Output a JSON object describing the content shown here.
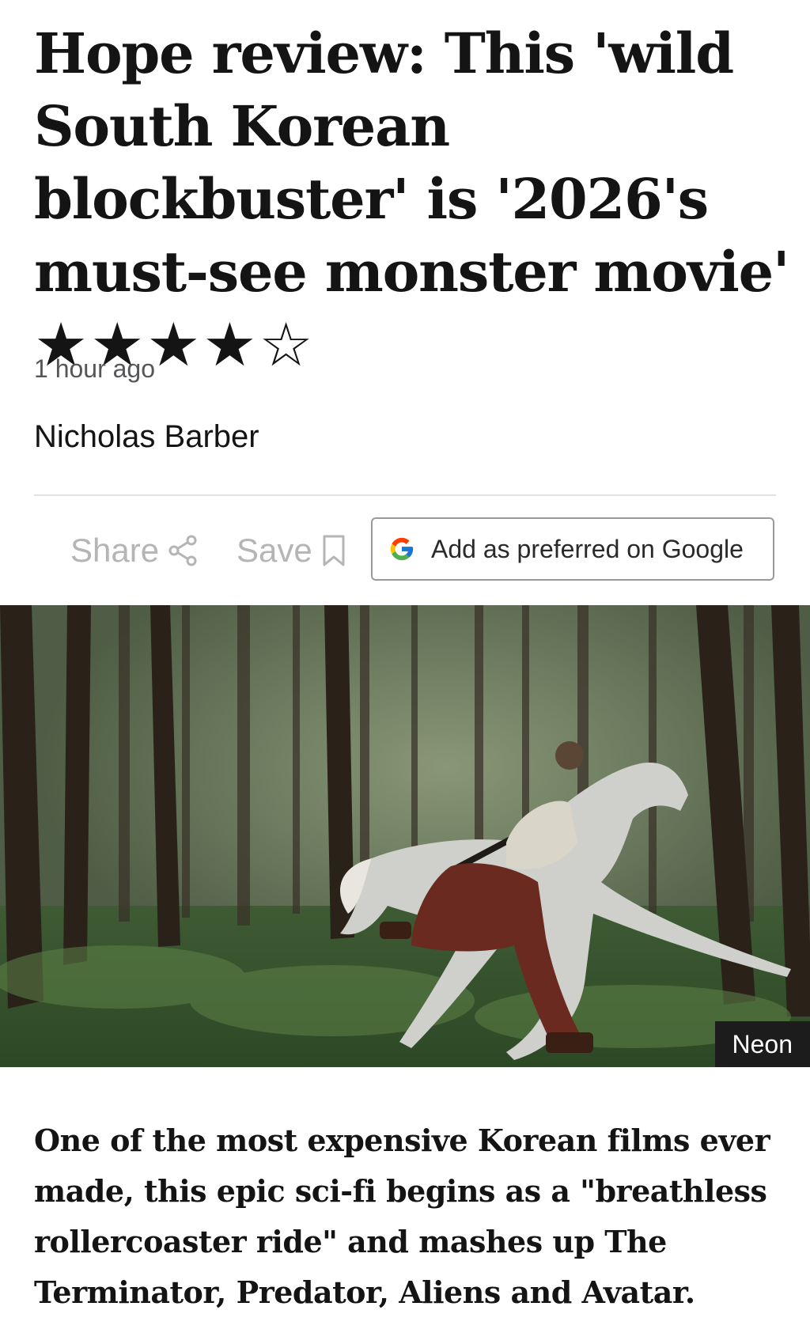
{
  "article": {
    "headline": "Hope review: This 'wild South Korean blockbuster' is '2026's must-see monster movie'",
    "rating_stars": "★★★★☆",
    "rating": {
      "value": 4,
      "max": 5
    },
    "timestamp": "1 hour ago",
    "author": "Nicholas Barber",
    "summary": "One of the most expensive Korean films ever made, this epic sci-fi begins as a \"breathless rollercoaster ride\" and mashes up The Terminator, Predator, Aliens and Avatar."
  },
  "toolbar": {
    "share_label": "Share",
    "save_label": "Save",
    "google_label": "Add as preferred on Google"
  },
  "hero_image": {
    "credit": "Neon",
    "description_icons": [
      "forest-scene",
      "horse-rider"
    ]
  },
  "colors": {
    "text": "#141414",
    "muted": "#545658",
    "toolbar_muted": "#b5b5b5",
    "divider": "#e2e2e2",
    "credit_bg": "#1c1c1c"
  }
}
